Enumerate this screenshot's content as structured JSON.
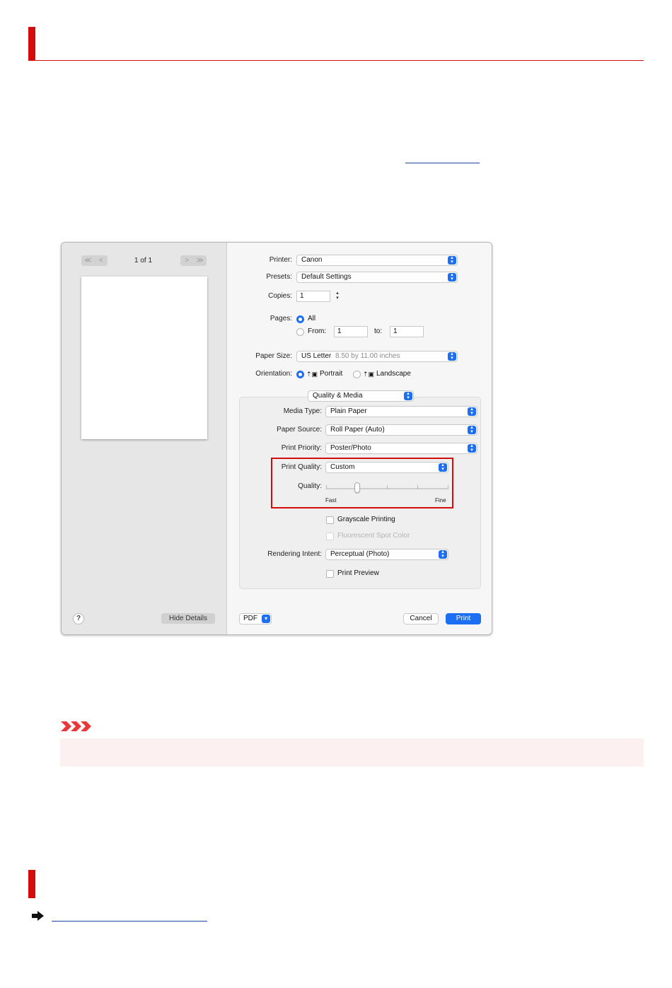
{
  "colors": {
    "accent_red": "#d40c0c",
    "mac_blue": "#1d6ff2",
    "note_bg": "#fdf0f0",
    "link_blue": "#1a46a8"
  },
  "dialog": {
    "preview": {
      "nav_first": "≪",
      "nav_prev": "<",
      "nav_next": ">",
      "nav_last": "≫",
      "page_count": "1 of 1"
    },
    "help_label": "?",
    "hide_details_label": "Hide Details",
    "printer": {
      "label": "Printer:",
      "value": "Canon"
    },
    "presets": {
      "label": "Presets:",
      "value": "Default Settings"
    },
    "copies": {
      "label": "Copies:",
      "value": "1"
    },
    "pages": {
      "label": "Pages:",
      "all_label": "All",
      "from_label": "From:",
      "from_value": "1",
      "to_label": "to:",
      "to_value": "1",
      "selected": "All"
    },
    "paper_size": {
      "label": "Paper Size:",
      "value": "US Letter",
      "detail": "8.50 by 11.00 inches"
    },
    "orientation": {
      "label": "Orientation:",
      "portrait_label": "Portrait",
      "landscape_label": "Landscape",
      "selected": "Portrait"
    },
    "panel_selector": "Quality & Media",
    "media_type": {
      "label": "Media Type:",
      "value": "Plain Paper"
    },
    "paper_source": {
      "label": "Paper Source:",
      "value": "Roll Paper (Auto)"
    },
    "print_priority": {
      "label": "Print Priority:",
      "value": "Poster/Photo"
    },
    "print_quality": {
      "label": "Print Quality:",
      "value": "Custom"
    },
    "quality_slider": {
      "label": "Quality:",
      "min_label": "Fast",
      "max_label": "Fine",
      "level": 0.25,
      "ticks": 5
    },
    "grayscale_label": "Grayscale Printing",
    "fluorescent_label": "Fluorescent Spot Color",
    "rendering_intent": {
      "label": "Rendering Intent:",
      "value": "Perceptual (Photo)"
    },
    "print_preview_label": "Print Preview",
    "pdf_label": "PDF",
    "cancel_label": "Cancel",
    "print_label": "Print"
  }
}
